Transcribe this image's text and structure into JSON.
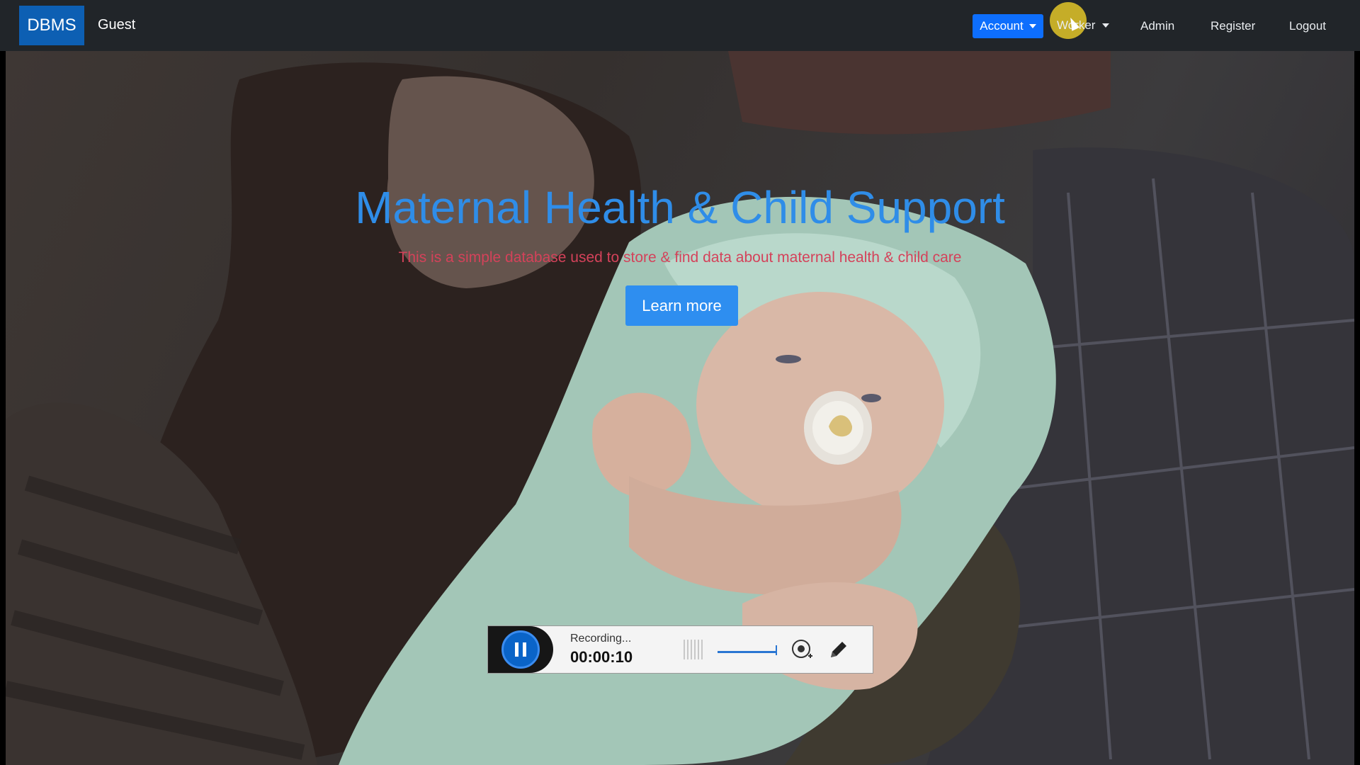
{
  "navbar": {
    "brand": "DBMS",
    "guest": "Guest",
    "account": "Account",
    "worker": "Worker",
    "admin": "Admin",
    "register": "Register",
    "logout": "Logout"
  },
  "hero": {
    "title": "Maternal Health & Child Support",
    "subtitle": "This is a simple database used to store & find data about maternal health & child care",
    "cta": "Learn more"
  },
  "recorder": {
    "status": "Recording...",
    "elapsed": "00:00:10",
    "icons": [
      "pause-icon",
      "audio-meter-icon",
      "volume-icon",
      "webcam-icon",
      "pencil-icon"
    ]
  },
  "colors": {
    "navbar_bg": "#212529",
    "brand_bg": "#0d5fb3",
    "account_bg": "#0d6efd",
    "title": "#2f8de8",
    "subtitle": "#d4425a",
    "cta_bg": "#2e8ef0"
  }
}
